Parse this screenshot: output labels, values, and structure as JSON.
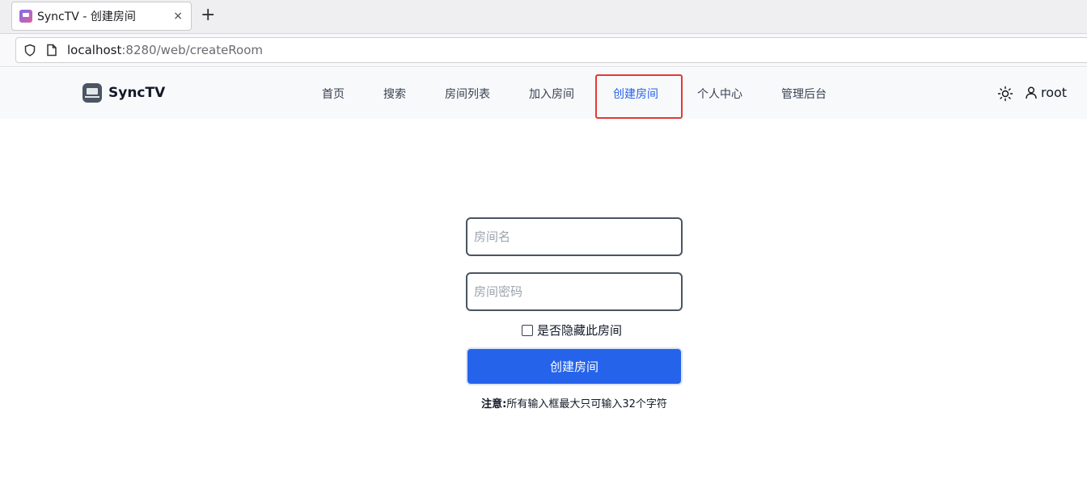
{
  "browser": {
    "tab_title": "SyncTV - 创建房间",
    "close_symbol": "×",
    "new_tab_symbol": "+",
    "url_host": "localhost",
    "url_rest": ":8280/web/createRoom"
  },
  "nav": {
    "brand": "SyncTV",
    "items": [
      "首页",
      "搜索",
      "房间列表",
      "加入房间",
      "创建房间",
      "个人中心",
      "管理后台"
    ],
    "active_index": 4,
    "username": "root"
  },
  "form": {
    "room_name_placeholder": "房间名",
    "room_password_placeholder": "房间密码",
    "hidden_label": "是否隐藏此房间",
    "submit_label": "创建房间",
    "note_prefix": "注意:",
    "note_text": "所有输入框最大只可输入32个字符"
  },
  "colors": {
    "accent": "#2563eb",
    "highlight": "#e53935"
  },
  "icons": [
    "shield-icon",
    "page-icon",
    "logo-icon",
    "theme-sun-icon",
    "user-icon"
  ]
}
